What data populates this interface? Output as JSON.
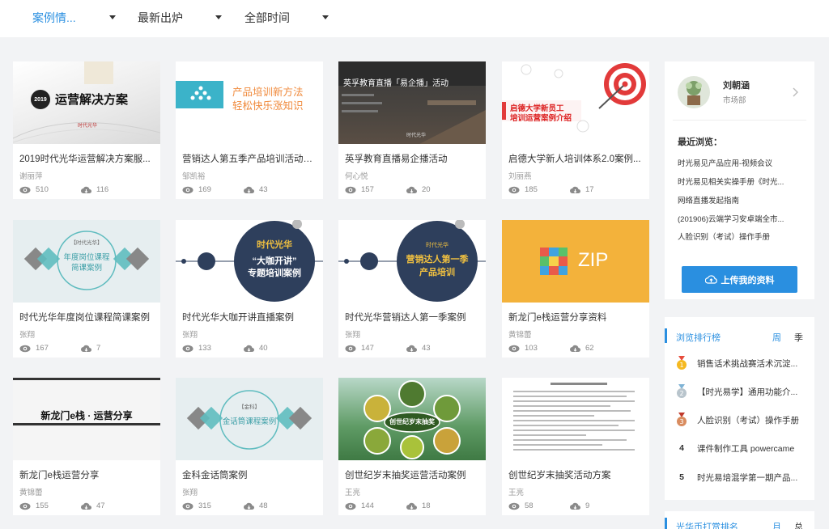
{
  "filters": [
    {
      "label": "案例情...",
      "active": true
    },
    {
      "label": "最新出炉",
      "active": false
    },
    {
      "label": "全部时间",
      "active": false
    }
  ],
  "cards": [
    {
      "title": "2019时代光华运营解决方案服...",
      "author": "谢丽萍",
      "views": "510",
      "downloads": "116",
      "thumb_text": "运营解决方案",
      "thumb_badge": "2019",
      "thumb_logo": "时代光华"
    },
    {
      "title": "营销达人第五季产品培训活动方案",
      "author": "邹凯裕",
      "views": "169",
      "downloads": "43",
      "thumb_text": "产品培训新方法",
      "thumb_text2": "轻松快乐涨知识"
    },
    {
      "title": "英孚教育直播易企播活动",
      "author": "何心悦",
      "views": "157",
      "downloads": "20",
      "thumb_text": "英孚教育直播「易企播」活动",
      "thumb_logo": "时代光华"
    },
    {
      "title": "启德大学新人培训体系2.0案例...",
      "author": "刘丽燕",
      "views": "185",
      "downloads": "17",
      "thumb_text": "启德大学新员工",
      "thumb_text2": "培训运营案例介绍"
    },
    {
      "title": "时代光华年度岗位课程简课案例",
      "author": "张翔",
      "views": "167",
      "downloads": "7",
      "thumb_badge": "【时代光华】",
      "thumb_text": "年度岗位课程",
      "thumb_text2": "简课案例"
    },
    {
      "title": "时代光华大咖开讲直播案例",
      "author": "张翔",
      "views": "133",
      "downloads": "40",
      "thumb_badge": "时代光华",
      "thumb_text": "“大咖开讲”",
      "thumb_text2": "专题培训案例"
    },
    {
      "title": "时代光华营销达人第一季案例",
      "author": "张翔",
      "views": "147",
      "downloads": "43",
      "thumb_badge": "时代光华",
      "thumb_text": "营销达人第一季",
      "thumb_text2": "产品培训"
    },
    {
      "title": "新龙门e栈运营分享资料",
      "author": "黄锦蕾",
      "views": "103",
      "downloads": "62",
      "thumb_text": "ZIP"
    },
    {
      "title": "新龙门e栈运营分享",
      "author": "黄锦蕾",
      "views": "155",
      "downloads": "47",
      "thumb_text": "新龙门e栈 · 运营分享"
    },
    {
      "title": "金科金话筒案例",
      "author": "张翔",
      "views": "315",
      "downloads": "48",
      "thumb_badge": "【金科】",
      "thumb_text": "金话筒课程案例"
    },
    {
      "title": "创世纪岁末抽奖运营活动案例",
      "author": "王亮",
      "views": "144",
      "downloads": "18",
      "thumb_text": "创世纪岁末抽奖"
    },
    {
      "title": "创世纪岁末抽奖活动方案",
      "author": "王亮",
      "views": "58",
      "downloads": "9",
      "thumb_text": ""
    }
  ],
  "user": {
    "name": "刘朝涵",
    "dept": "市场部",
    "recent_title": "最近浏览：",
    "recent": [
      "时光易见产品应用-视频会议",
      "时光易见相关实操手册《时光...",
      "网络直播发起指南",
      "(201906)云端学习安卓端全市...",
      "人脸识别（考试）操作手册"
    ],
    "upload_label": "上传我的资料"
  },
  "ranking": {
    "title": "浏览排行榜",
    "tabs": [
      "周",
      "季"
    ],
    "items": [
      {
        "rank": "1",
        "text": "销售话术挑战赛活术沉淀..."
      },
      {
        "rank": "2",
        "text": "【时光易学】通用功能介..."
      },
      {
        "rank": "3",
        "text": "人脸识别（考试）操作手册"
      },
      {
        "rank": "4",
        "text": "课件制作工具 powercame"
      },
      {
        "rank": "5",
        "text": "时光易培混学第一期产品..."
      }
    ]
  },
  "coins": {
    "title": "光华币打赏排名",
    "tabs": [
      "月",
      "总"
    ]
  },
  "colors": {
    "accent": "#2a8fe0",
    "background": "#f2f3f5"
  },
  "icons": {
    "views": "eye-icon",
    "downloads": "cloud-download-icon",
    "upload": "cloud-upload-icon",
    "chevron": "chevron-right-icon"
  }
}
